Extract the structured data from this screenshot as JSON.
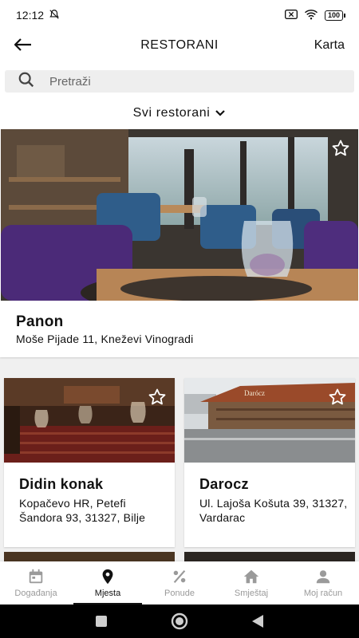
{
  "status_bar": {
    "time": "12:12",
    "battery": "100"
  },
  "header": {
    "title": "RESTORANI",
    "back_icon": "arrow-left-icon",
    "map_label": "Karta"
  },
  "search": {
    "placeholder": "Pretraži",
    "value": ""
  },
  "filter": {
    "label": "Svi restorani"
  },
  "restaurants": [
    {
      "name": "Panon",
      "address": "Moše Pijade 11, Kneževi Vinogradi"
    },
    {
      "name": "Didin konak",
      "address": "Kopačevo HR, Petefi Šandora 93, 31327, Bilje"
    },
    {
      "name": "Darocz",
      "address": "Ul. Lajoša Košuta 39, 31327, Vardarac",
      "sign_text": "Darócz"
    }
  ],
  "bottom_nav": {
    "items": [
      {
        "label": "Događanja",
        "icon": "calendar-icon",
        "active": false
      },
      {
        "label": "Mjesta",
        "icon": "map-pin-icon",
        "active": true
      },
      {
        "label": "Ponude",
        "icon": "percent-icon",
        "active": false
      },
      {
        "label": "Smještaj",
        "icon": "house-icon",
        "active": false
      },
      {
        "label": "Moj račun",
        "icon": "person-icon",
        "active": false
      }
    ]
  },
  "colors": {
    "active": "#111111",
    "inactive": "#9a9a9a",
    "search_bg": "#eeeeee",
    "accent_purple": "#5a2d8a"
  }
}
